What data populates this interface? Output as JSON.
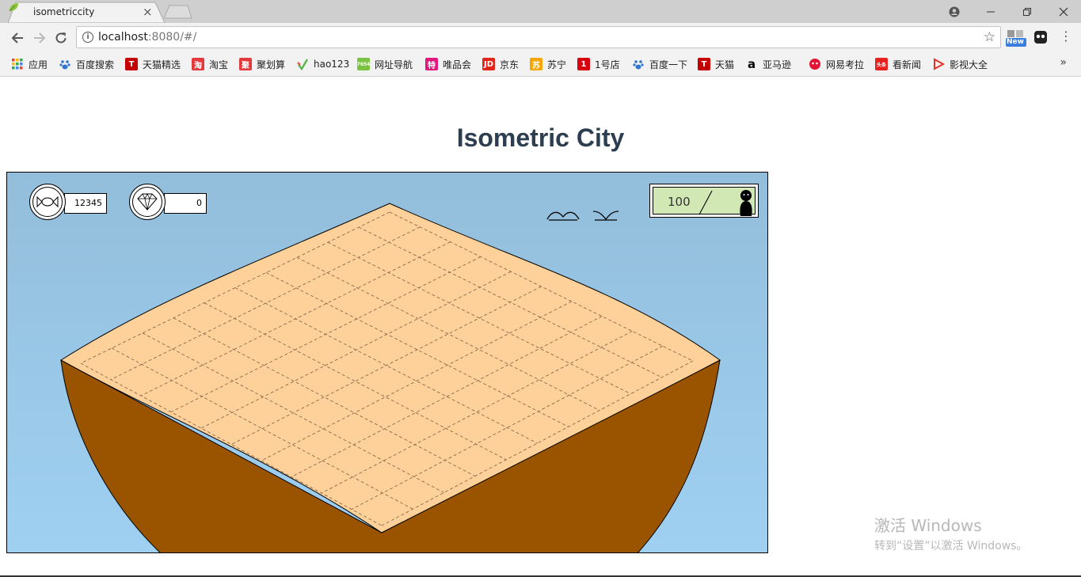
{
  "browser": {
    "tab_title": "isometriccity",
    "tab_close": "×",
    "url_host": "localhost",
    "url_rest": ":8080/#/",
    "ext_badge": "New"
  },
  "bookmarks": [
    {
      "label": "应用",
      "icon": "apps-grid-icon",
      "color": "#4285f4"
    },
    {
      "label": "百度搜索",
      "icon": "baidu-paw-icon",
      "color": "#2f74d0"
    },
    {
      "label": "天猫精选",
      "icon": "tmall-icon",
      "color": "#c40000",
      "glyph": "T"
    },
    {
      "label": "淘宝",
      "icon": "taobao-icon",
      "color": "#e4393c",
      "glyph": "淘"
    },
    {
      "label": "聚划算",
      "icon": "juhuasuan-icon",
      "color": "#e4393c",
      "glyph": "聚"
    },
    {
      "label": "hao123",
      "icon": "hao123-icon",
      "color": "#5db34b"
    },
    {
      "label": "网址导航",
      "icon": "nav-7654-icon",
      "color": "#7cc242",
      "glyph": "7654"
    },
    {
      "label": "唯品会",
      "icon": "vip-icon",
      "color": "#e2187f",
      "glyph": "特"
    },
    {
      "label": "京东",
      "icon": "jd-icon",
      "color": "#e1251b",
      "glyph": "JD"
    },
    {
      "label": "苏宁",
      "icon": "suning-icon",
      "color": "#f7a600",
      "glyph": "苏"
    },
    {
      "label": "1号店",
      "icon": "yhd-icon",
      "color": "#d7000f",
      "glyph": "1"
    },
    {
      "label": "百度一下",
      "icon": "baidu-paw-icon",
      "color": "#2f74d0"
    },
    {
      "label": "天猫",
      "icon": "tmall-icon",
      "color": "#c40000",
      "glyph": "T"
    },
    {
      "label": "亚马逊",
      "icon": "amazon-icon",
      "color": "#000000",
      "glyph": "a"
    },
    {
      "label": "网易考拉",
      "icon": "kaola-icon",
      "color": "#e31436"
    },
    {
      "label": "看新闻",
      "icon": "toutiao-icon",
      "color": "#e8201f",
      "glyph": "头条"
    },
    {
      "label": "影视大全",
      "icon": "video-play-icon",
      "color": "#e5312a"
    }
  ],
  "page": {
    "title": "Isometric City"
  },
  "game": {
    "resources": [
      {
        "name": "candy",
        "icon": "candy-icon",
        "value": "12345"
      },
      {
        "name": "diamond",
        "icon": "diamond-icon",
        "value": "0"
      }
    ],
    "population": {
      "value": "100",
      "icon": "person-icon"
    },
    "colors": {
      "sky_top": "#93bedb",
      "sky_bottom": "#9fd0f2",
      "land_top": "#ffd19a",
      "soil": "#9a5400"
    }
  },
  "watermark": {
    "line1": "激活 Windows",
    "line2": "转到“设置”以激活 Windows。"
  }
}
